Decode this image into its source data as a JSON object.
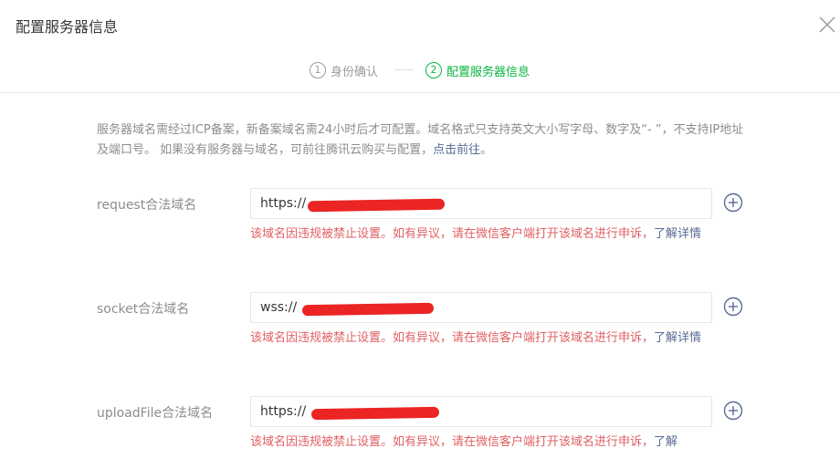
{
  "dialog": {
    "title": "配置服务器信息"
  },
  "steps": [
    {
      "num": "1",
      "label": "身份确认",
      "state": "done"
    },
    {
      "num": "2",
      "label": "配置服务器信息",
      "state": "current"
    }
  ],
  "notice": {
    "text": "服务器域名需经过ICP备案，新备案域名需24小时后才可配置。域名格式只支持英文大小写字母、数字及“- ”，不支持IP地址及端口号。 如果没有服务器与域名，可前往腾讯云购买与配置，",
    "link": "点击前往",
    "end": "。"
  },
  "fields": [
    {
      "label": "request合法域名",
      "prefix": "https://",
      "error": "该域名因违规被禁止设置。如有异议，请在微信客户端打开该域名进行申诉，",
      "error_link": "了解详情"
    },
    {
      "label": "socket合法域名",
      "prefix": "wss://",
      "error": "该域名因违规被禁止设置。如有异议，请在微信客户端打开该域名进行申诉，",
      "error_link": "了解详情"
    },
    {
      "label": "uploadFile合法域名",
      "prefix": "https://",
      "error": "该域名因违规被禁止设置。如有异议，请在微信客户端打开该域名进行申诉，",
      "error_link": "了解"
    }
  ],
  "colors": {
    "accent_green": "#07b53f",
    "error_red": "#e15f63",
    "link_blue": "#576b95",
    "redaction_red": "#ea1818"
  },
  "icons": {
    "close": "close-icon",
    "add": "plus-circle-icon"
  }
}
